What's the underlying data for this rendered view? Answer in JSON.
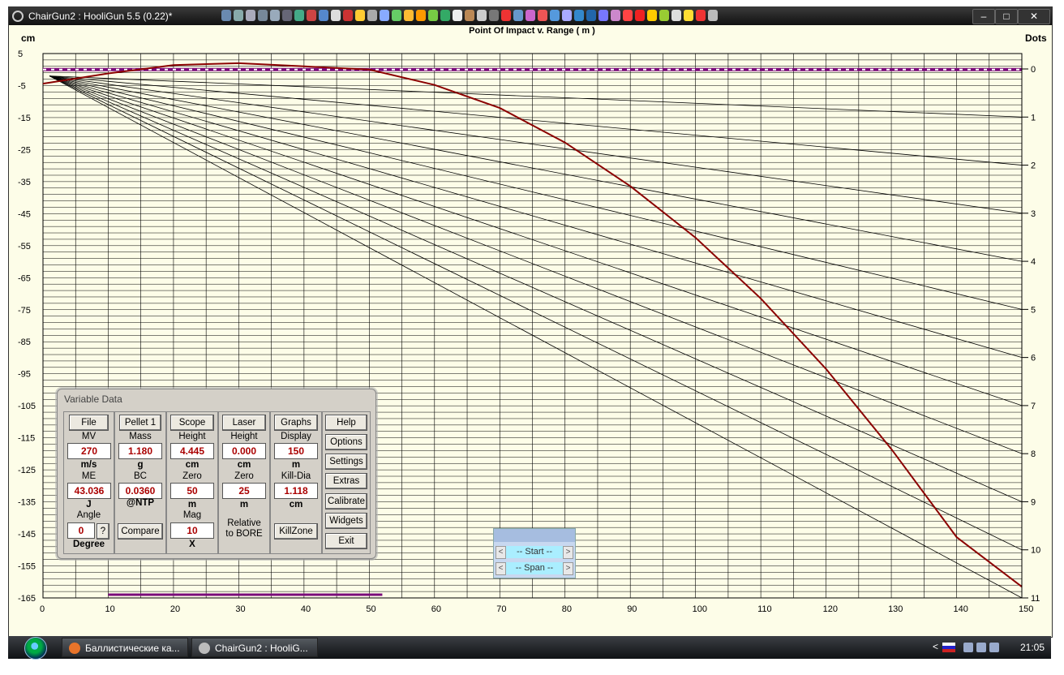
{
  "window": {
    "title": "ChairGun2 : HooliGun 5.5 (0.22)*",
    "controls": {
      "minimize": "–",
      "maximize": "□",
      "close": "✕"
    }
  },
  "plot": {
    "title": "Point Of Impact v. Range ( m )",
    "left_unit": "cm",
    "right_unit": "Dots"
  },
  "chart_data": {
    "type": "line",
    "title": "Point Of Impact v. Range ( m )",
    "xlabel": "Range (m)",
    "ylabel": "cm",
    "y2label": "Dots",
    "xlim": [
      0,
      150
    ],
    "ylim": [
      -165,
      5
    ],
    "y2lim": [
      0,
      11
    ],
    "x_ticks": [
      0,
      10,
      20,
      30,
      40,
      50,
      60,
      70,
      80,
      90,
      100,
      110,
      120,
      130,
      140,
      150
    ],
    "y_ticks": [
      5,
      -5,
      -15,
      -25,
      -35,
      -45,
      -55,
      -65,
      -75,
      -85,
      -95,
      -105,
      -115,
      -125,
      -135,
      -145,
      -155,
      -165
    ],
    "y2_ticks": [
      0,
      1,
      2,
      3,
      4,
      5,
      6,
      7,
      8,
      9,
      10,
      11
    ],
    "grid": true,
    "killzone_bar": {
      "from": 10,
      "to": 52,
      "color": "#7a0a7a"
    },
    "killzone_band": {
      "center": 0.0,
      "color": "#7a0a7a"
    },
    "mildot_lines_dots": [
      1,
      2,
      3,
      4,
      5,
      6,
      7,
      8,
      9,
      10,
      11
    ],
    "series": [
      {
        "name": "Trajectory",
        "color": "#8b0000",
        "x": [
          0,
          10,
          20,
          30,
          40,
          50,
          60,
          70,
          80,
          90,
          100,
          110,
          120,
          130,
          140,
          150
        ],
        "y": [
          -4.4,
          -1.2,
          1.4,
          2.0,
          1.0,
          0.0,
          -4.8,
          -12.0,
          -22.8,
          -36.4,
          -52.5,
          -71.5,
          -93.5,
          -118.5,
          -146.0,
          -161.5
        ]
      }
    ]
  },
  "variable_data": {
    "title": "Variable Data",
    "col1": {
      "button": "File",
      "mv_label": "MV",
      "mv": "270",
      "mv_unit": "m/s",
      "me_label": "ME",
      "me": "43.036",
      "me_unit": "J",
      "angle_label": "Angle",
      "angle": "0",
      "angle_help": "?",
      "angle_unit": "Degree"
    },
    "col2": {
      "button": "Pellet 1",
      "mass_label": "Mass",
      "mass": "1.180",
      "mass_unit": "g",
      "bc_label": "BC",
      "bc": "0.0360",
      "bc_unit": "@NTP",
      "compare": "Compare"
    },
    "col3": {
      "button": "Scope",
      "height_label": "Height",
      "height": "4.445",
      "height_unit": "cm",
      "zero_label": "Zero",
      "zero": "50",
      "zero_unit": "m",
      "mag_label": "Mag",
      "mag": "10",
      "mag_unit": "X"
    },
    "col4": {
      "button": "Laser",
      "height_label": "Height",
      "height": "0.000",
      "height_unit": "cm",
      "zero_label": "Zero",
      "zero": "25",
      "zero_unit": "m",
      "relative": "Relative",
      "to_bore": "to BORE"
    },
    "col5": {
      "button": "Graphs",
      "display_label": "Display",
      "display": "150",
      "display_unit": "m",
      "killdia_label": "Kill-Dia",
      "killdia": "1.118",
      "killdia_unit": "cm",
      "killzone": "KillZone"
    },
    "col6": {
      "help": "Help",
      "options": "Options",
      "settings": "Settings",
      "extras": "Extras",
      "calibrate": "Calibrate",
      "widgets": "Widgets",
      "exit": "Exit"
    }
  },
  "start_span": {
    "start": "-- Start --",
    "span": "-- Span --",
    "left": "<",
    "right": ">"
  },
  "taskbar": {
    "items": [
      {
        "label": "Баллистические ка...",
        "color": "#e8742a"
      },
      {
        "label": "ChairGun2 : HooliG...",
        "color": "#bbbbbb"
      }
    ],
    "tray": {
      "chevron": "<",
      "clock": "21:05"
    }
  }
}
